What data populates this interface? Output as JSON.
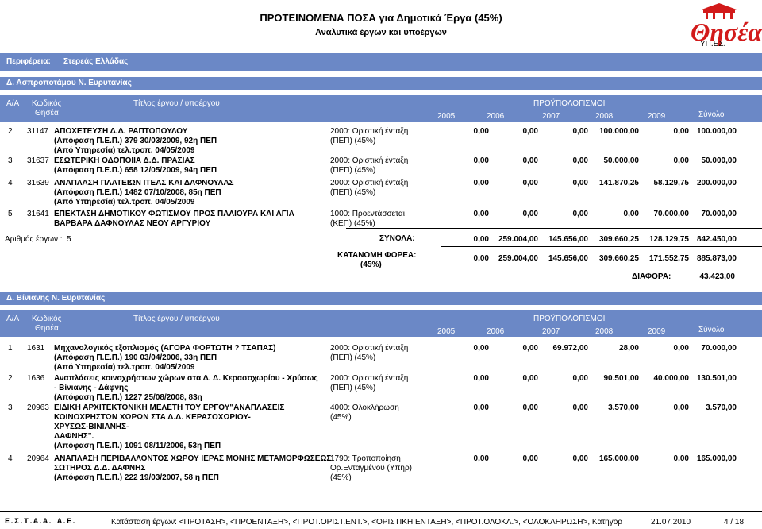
{
  "header": {
    "title": "ΠΡΟΤΕΙΝΟΜΕΝΑ ΠΟΣΑ για Δημοτικά Έργα (45%)",
    "subtitle": "Αναλυτικά έργων και υποέργων",
    "logo_text": "Θησέας",
    "logo_sub": "ΥΠ.ΕΣ."
  },
  "region": {
    "label": "Περιφέρεια:",
    "value": "Στερεάς Ελλάδας"
  },
  "columns": {
    "aa": "Α/Α",
    "code1": "Κωδικός",
    "code2": "Θησέα",
    "title": "Τίτλος έργου / υποέργου",
    "budget": "ΠΡΟΫΠΟΛΟΓΙΣΜΟΙ",
    "years": [
      "2005",
      "2006",
      "2007",
      "2008",
      "2009",
      "Σύνολο"
    ]
  },
  "section1": {
    "name": "Δ. Ασπροποτάμου Ν. Ευρυτανίας",
    "rows": [
      {
        "aa": "2",
        "code": "31147",
        "lines": [
          "ΑΠΟΧΕΤΕΥΣΗ Δ.Δ. ΡΑΠΤΟΠΟΥΛΟΥ",
          "(Απόφαση Π.Ε.Π.) 379 30/03/2009, 92η ΠΕΠ",
          "(Από   Υπηρεσία) τελ.τροπ. 04/05/2009"
        ],
        "status": [
          "2000: Οριστική ένταξη",
          "(ΠΕΠ) (45%)"
        ],
        "vals": [
          "0,00",
          "0,00",
          "0,00",
          "100.000,00",
          "0,00",
          "100.000,00"
        ]
      },
      {
        "aa": "3",
        "code": "31637",
        "lines": [
          "ΕΣΩΤΕΡΙΚΗ ΟΔΟΠΟΙΙΑ Δ.Δ. ΠΡΑΣΙΑΣ",
          "(Απόφαση Π.Ε.Π.) 658 12/05/2009, 94η ΠΕΠ"
        ],
        "status": [
          "2000: Οριστική ένταξη",
          "(ΠΕΠ) (45%)"
        ],
        "vals": [
          "0,00",
          "0,00",
          "0,00",
          "50.000,00",
          "0,00",
          "50.000,00"
        ]
      },
      {
        "aa": "4",
        "code": "31639",
        "lines": [
          "ΑΝΑΠΛΑΣΗ ΠΛΑΤΕΙΩΝ ΙΤΕΑΣ ΚΑΙ ΔΑΦΝΟΥΛΑΣ",
          "(Απόφαση Π.Ε.Π.) 1482 07/10/2008, 85η ΠΕΠ",
          "(Από   Υπηρεσία) τελ.τροπ. 04/05/2009"
        ],
        "status": [
          "2000: Οριστική ένταξη",
          "(ΠΕΠ) (45%)"
        ],
        "vals": [
          "0,00",
          "0,00",
          "0,00",
          "141.870,25",
          "58.129,75",
          "200.000,00"
        ]
      },
      {
        "aa": "5",
        "code": "31641",
        "lines": [
          "ΕΠΕΚΤΑΣΗ ΔΗΜΟΤΙΚΟΥ ΦΩΤΙΣΜΟΥ ΠΡΟΣ ΠΑΛΙΟΥΡΑ ΚΑΙ ΑΓΙΑ",
          "ΒΑΡΒΑΡΑ ΔΑΦΝΟΥΛΑΣ   ΝΕΟΥ ΑΡΓΥΡΙΟΥ"
        ],
        "status": [
          "1000: Προεντάσσεται",
          "(ΚΕΠ) (45%)"
        ],
        "vals": [
          "0,00",
          "0,00",
          "0,00",
          "0,00",
          "70.000,00",
          "70.000,00"
        ]
      }
    ],
    "count_label": "Αριθμός έργων :",
    "count_value": "5",
    "totals_label": "ΣΥΝΟΛΑ:",
    "totals": [
      "0,00",
      "259.004,00",
      "145.656,00",
      "309.660,25",
      "128.129,75",
      "842.450,00"
    ],
    "agency_label1": "ΚΑΤΑΝΟΜΗ ΦΟΡΕΑ:",
    "agency_label2": "(45%)",
    "agency": [
      "0,00",
      "259.004,00",
      "145.656,00",
      "309.660,25",
      "171.552,75",
      "885.873,00"
    ],
    "diff_label": "ΔΙΑΦΟΡΑ:",
    "diff_value": "43.423,00"
  },
  "section2": {
    "name": "Δ. Βίνιανης Ν. Ευρυτανίας",
    "rows": [
      {
        "aa": "1",
        "code": "1631",
        "lines": [
          "Μηχανολογικός εξοπλισμός (ΑΓΟΡΑ ΦΟΡΤΩΤΗ ? ΤΣΑΠΑΣ)",
          "(Απόφαση Π.Ε.Π.) 190 03/04/2006, 33η ΠΕΠ",
          "(Από   Υπηρεσία) τελ.τροπ. 04/05/2009"
        ],
        "status": [
          "2000: Οριστική ένταξη",
          "(ΠΕΠ) (45%)"
        ],
        "vals": [
          "0,00",
          "0,00",
          "69.972,00",
          "28,00",
          "0,00",
          "70.000,00"
        ]
      },
      {
        "aa": "2",
        "code": "1636",
        "lines": [
          "Αναπλάσεις κοινοχρήστων χώρων στα Δ. Δ. Κερασοχωρίου - Χρύσως",
          "- Βίνιανης - Δάφνης",
          "(Απόφαση Π.Ε.Π.) 1227 25/08/2008, 83η"
        ],
        "status": [
          "2000: Οριστική ένταξη",
          "(ΠΕΠ) (45%)"
        ],
        "vals": [
          "0,00",
          "0,00",
          "0,00",
          "90.501,00",
          "40.000,00",
          "130.501,00"
        ]
      },
      {
        "aa": "3",
        "code": "20963",
        "lines": [
          " ΕΙΔΙΚΗ ΑΡΧΙΤΕΚΤΟΝΙΚΗ ΜΕΛΕΤΗ ΤΟΥ ΕΡΓΟΥ\"ΑΝΑΠΛΑΣΕΙΣ",
          "ΚΟΙΝΟΧΡΗΣΤΩΝ ΧΩΡΩΝ ΣΤΑ Δ.Δ. ΚΕΡΑΣΟΧΩΡΙΟΥ-",
          "ΧΡΥΣΩΣ-ΒΙΝΙΑΝΗΣ-",
          "ΔΑΦΝΗΣ\".",
          "(Απόφαση Π.Ε.Π.) 1091 08/11/2006, 53η ΠΕΠ"
        ],
        "status": [
          "4000: Ολοκλήρωση",
          "(45%)"
        ],
        "vals": [
          "0,00",
          "0,00",
          "0,00",
          "3.570,00",
          "0,00",
          "3.570,00"
        ]
      },
      {
        "aa": "4",
        "code": "20964",
        "lines": [
          "ΑΝΑΠΛΑΣΗ ΠΕΡΙΒΑΛΛΟΝΤΟΣ ΧΩΡΟΥ ΙΕΡΑΣ ΜΟΝΗΣ ΜΕΤΑΜΟΡΦΩΣΕΩΣ",
          "ΣΩΤΗΡΟΣ Δ.Δ. ΔΑΦΝΗΣ",
          "(Απόφαση Π.Ε.Π.) 222 19/03/2007, 58 η ΠΕΠ"
        ],
        "status": [
          "1790: Τροποποίηση",
          "Ορ.Ενταγμένου (Υπηρ)",
          "(45%)"
        ],
        "vals": [
          "0,00",
          "0,00",
          "0,00",
          "165.000,00",
          "0,00",
          "165.000,00"
        ]
      }
    ]
  },
  "footer": {
    "left": "Ε.Σ.Τ.Α.Α. Α.Ε.",
    "middle": "Κατάσταση έργων: <ΠΡΟΤΑΣΗ>, <ΠΡΟΕΝΤΑΞΗ>, <ΠΡΟΤ.ΟΡΙΣΤ.ΕΝΤ.>, <ΟΡΙΣΤΙΚΗ ΕΝΤΑΞΗ>, <ΠΡΟΤ.ΟΛΟΚΛ.>, <ΟΛΟΚΛΗΡΩΣΗ>, Κατηγορ",
    "date": "21.07.2010",
    "page": "4 / 18"
  }
}
